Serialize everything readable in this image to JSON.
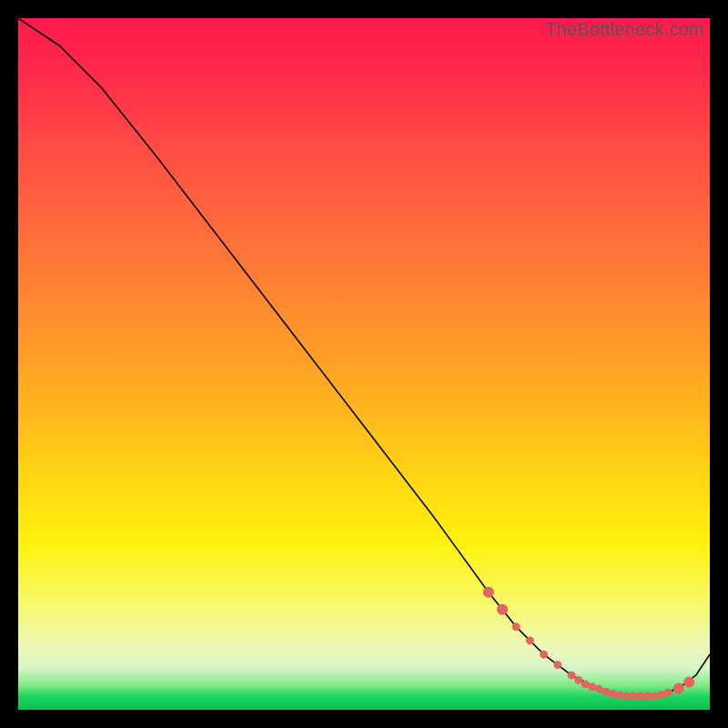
{
  "watermark": "TheBottleneck.com",
  "chart_data": {
    "type": "line",
    "title": "",
    "xlabel": "",
    "ylabel": "",
    "xlim": [
      0,
      100
    ],
    "ylim": [
      0,
      100
    ],
    "grid": false,
    "legend": false,
    "series": [
      {
        "name": "bottleneck-curve",
        "x": [
          0,
          6,
          12,
          20,
          30,
          40,
          50,
          60,
          68,
          72,
          76,
          80,
          84,
          86,
          88,
          90,
          92,
          94,
          96,
          98,
          100
        ],
        "y": [
          100,
          96,
          90,
          80,
          67,
          54,
          41,
          28,
          17,
          12,
          8,
          5,
          3,
          2,
          2,
          2,
          2,
          2.5,
          3.5,
          5,
          8
        ]
      }
    ],
    "markers": {
      "name": "highlight-points",
      "x": [
        68,
        70,
        72,
        74,
        76,
        78,
        80,
        81,
        82,
        83,
        84,
        85,
        86,
        87,
        88,
        89,
        90,
        91,
        92,
        93,
        94,
        95.5,
        97
      ],
      "y": [
        17,
        14.5,
        12,
        10,
        8,
        6.5,
        5,
        4.3,
        3.7,
        3.3,
        3,
        2.6,
        2.3,
        2.1,
        2,
        2,
        2,
        2,
        2,
        2.2,
        2.5,
        3.1,
        4
      ],
      "color": "#e0675f",
      "size_small": 4.5,
      "size_large": 6
    },
    "background_gradient": {
      "type": "vertical",
      "stops": [
        {
          "pos": 0.0,
          "color": "#ff1a4d"
        },
        {
          "pos": 0.3,
          "color": "#ff6a3c"
        },
        {
          "pos": 0.67,
          "color": "#ffd813"
        },
        {
          "pos": 0.91,
          "color": "#eef7b8"
        },
        {
          "pos": 1.0,
          "color": "#0ac052"
        }
      ]
    }
  }
}
